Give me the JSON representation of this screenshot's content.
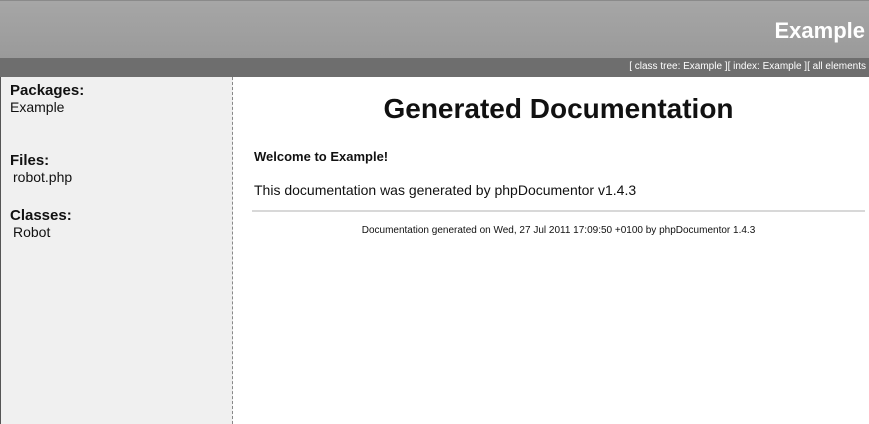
{
  "header": {
    "title": "Example"
  },
  "nav": {
    "class_tree": "[ class tree: Example ]",
    "index": "[ index: Example ]",
    "all_elements": "[ all elements"
  },
  "sidebar": {
    "packages_heading": "Packages:",
    "packages": [
      "Example"
    ],
    "files_heading": "Files:",
    "files": [
      "robot.php"
    ],
    "classes_heading": "Classes:",
    "classes": [
      "Robot"
    ]
  },
  "main": {
    "title": "Generated Documentation",
    "welcome": "Welcome to Example!",
    "body": "This documentation was generated by phpDocumentor v1.4.3",
    "footer": "Documentation generated on Wed, 27 Jul 2011 17:09:50 +0100 by phpDocumentor 1.4.3"
  }
}
